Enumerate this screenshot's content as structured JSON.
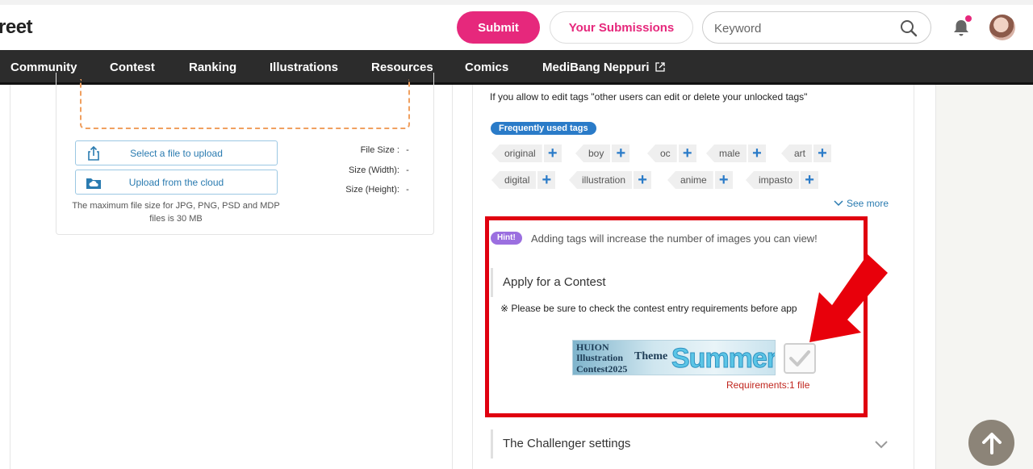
{
  "header": {
    "logo_text": "reet",
    "submit_label": "Submit",
    "your_submissions_label": "Your Submissions",
    "search_placeholder": "Keyword"
  },
  "nav": {
    "items": [
      "Community",
      "Contest",
      "Ranking",
      "Illustrations",
      "Resources",
      "Comics",
      "MediBang Neppuri"
    ]
  },
  "upload": {
    "select_file_label": "Select a file to upload",
    "cloud_label": "Upload from the cloud",
    "max_note": "The maximum file size for JPG, PNG, PSD and MDP files is 30 MB",
    "file_size_label": "File Size :",
    "file_size_value": "-",
    "width_label": "Size (Width):",
    "width_value": "-",
    "height_label": "Size (Height):",
    "height_value": "-"
  },
  "tags": {
    "allow_text": "If you allow to edit tags \"other users can edit or delete your unlocked tags\"",
    "frequent_label": "Frequently used tags",
    "row1": [
      "original",
      "boy",
      "oc",
      "male",
      "art"
    ],
    "row2": [
      "digital",
      "illustration",
      "anime",
      "impasto"
    ],
    "see_more": "See more"
  },
  "hint": {
    "badge": "Hint!",
    "text": "Adding tags will increase the number of images you can view!"
  },
  "contest": {
    "title": "Apply for a Contest",
    "notice": "※ Please be sure to check the contest entry requirements before app",
    "banner_line1": "HUION",
    "banner_line2": "Illustration",
    "banner_line3": "Contest2025",
    "banner_theme": "Theme",
    "banner_word": "Summer",
    "requirements": "Requirements:1 file"
  },
  "challenger": {
    "title": "The Challenger settings"
  },
  "colors": {
    "brand_pink": "#e6287c",
    "nav_bg": "#2c2c2c",
    "highlight_red": "#e0000f",
    "tag_blue": "#2a7bc8"
  }
}
